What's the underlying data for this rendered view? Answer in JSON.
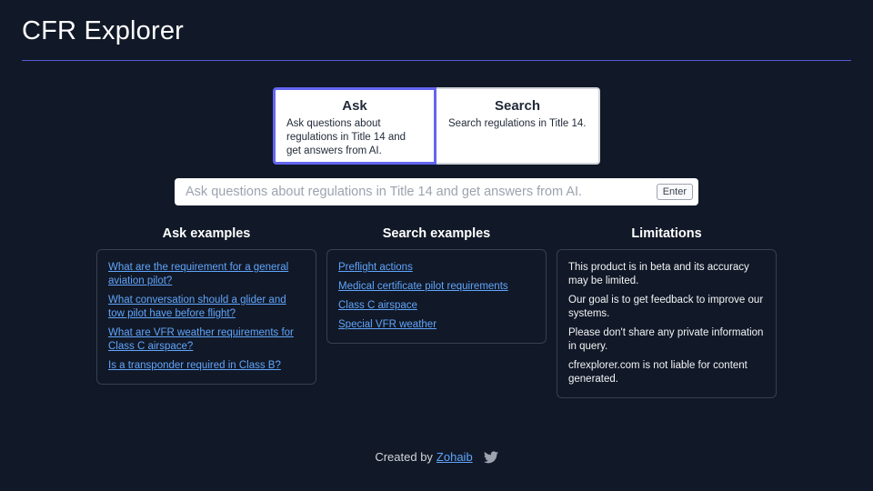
{
  "header": {
    "title": "CFR Explorer"
  },
  "modes": [
    {
      "title": "Ask",
      "description": "Ask questions about regulations in Title 14 and get answers from AI.",
      "active": true
    },
    {
      "title": "Search",
      "description": "Search regulations in Title 14.",
      "active": false
    }
  ],
  "search": {
    "placeholder": "Ask questions about regulations in Title 14 and get answers from AI.",
    "value": "",
    "enter_label": "Enter"
  },
  "ask_examples": {
    "title": "Ask examples",
    "items": [
      "What are the requirement for a general aviation pilot?",
      "What conversation should a glider and tow pilot have before flight?",
      "What are VFR weather requirements for Class C airspace?",
      "Is a transponder required in Class B?"
    ]
  },
  "search_examples": {
    "title": "Search examples",
    "items": [
      "Preflight actions",
      "Medical certificate pilot requirements",
      "Class C airspace",
      "Special VFR weather"
    ]
  },
  "limitations": {
    "title": "Limitations",
    "items": [
      "This product is in beta and its accuracy may be limited.",
      "Our goal is to get feedback to improve our systems.",
      "Please don't share any private information in query.",
      "cfrexplorer.com is not liable for content generated."
    ]
  },
  "footer": {
    "prefix": "Created by",
    "author": "Zohaib",
    "icon": "twitter-icon"
  },
  "colors": {
    "background": "#111827",
    "accent": "#6366f1",
    "link": "#60a5fa"
  }
}
